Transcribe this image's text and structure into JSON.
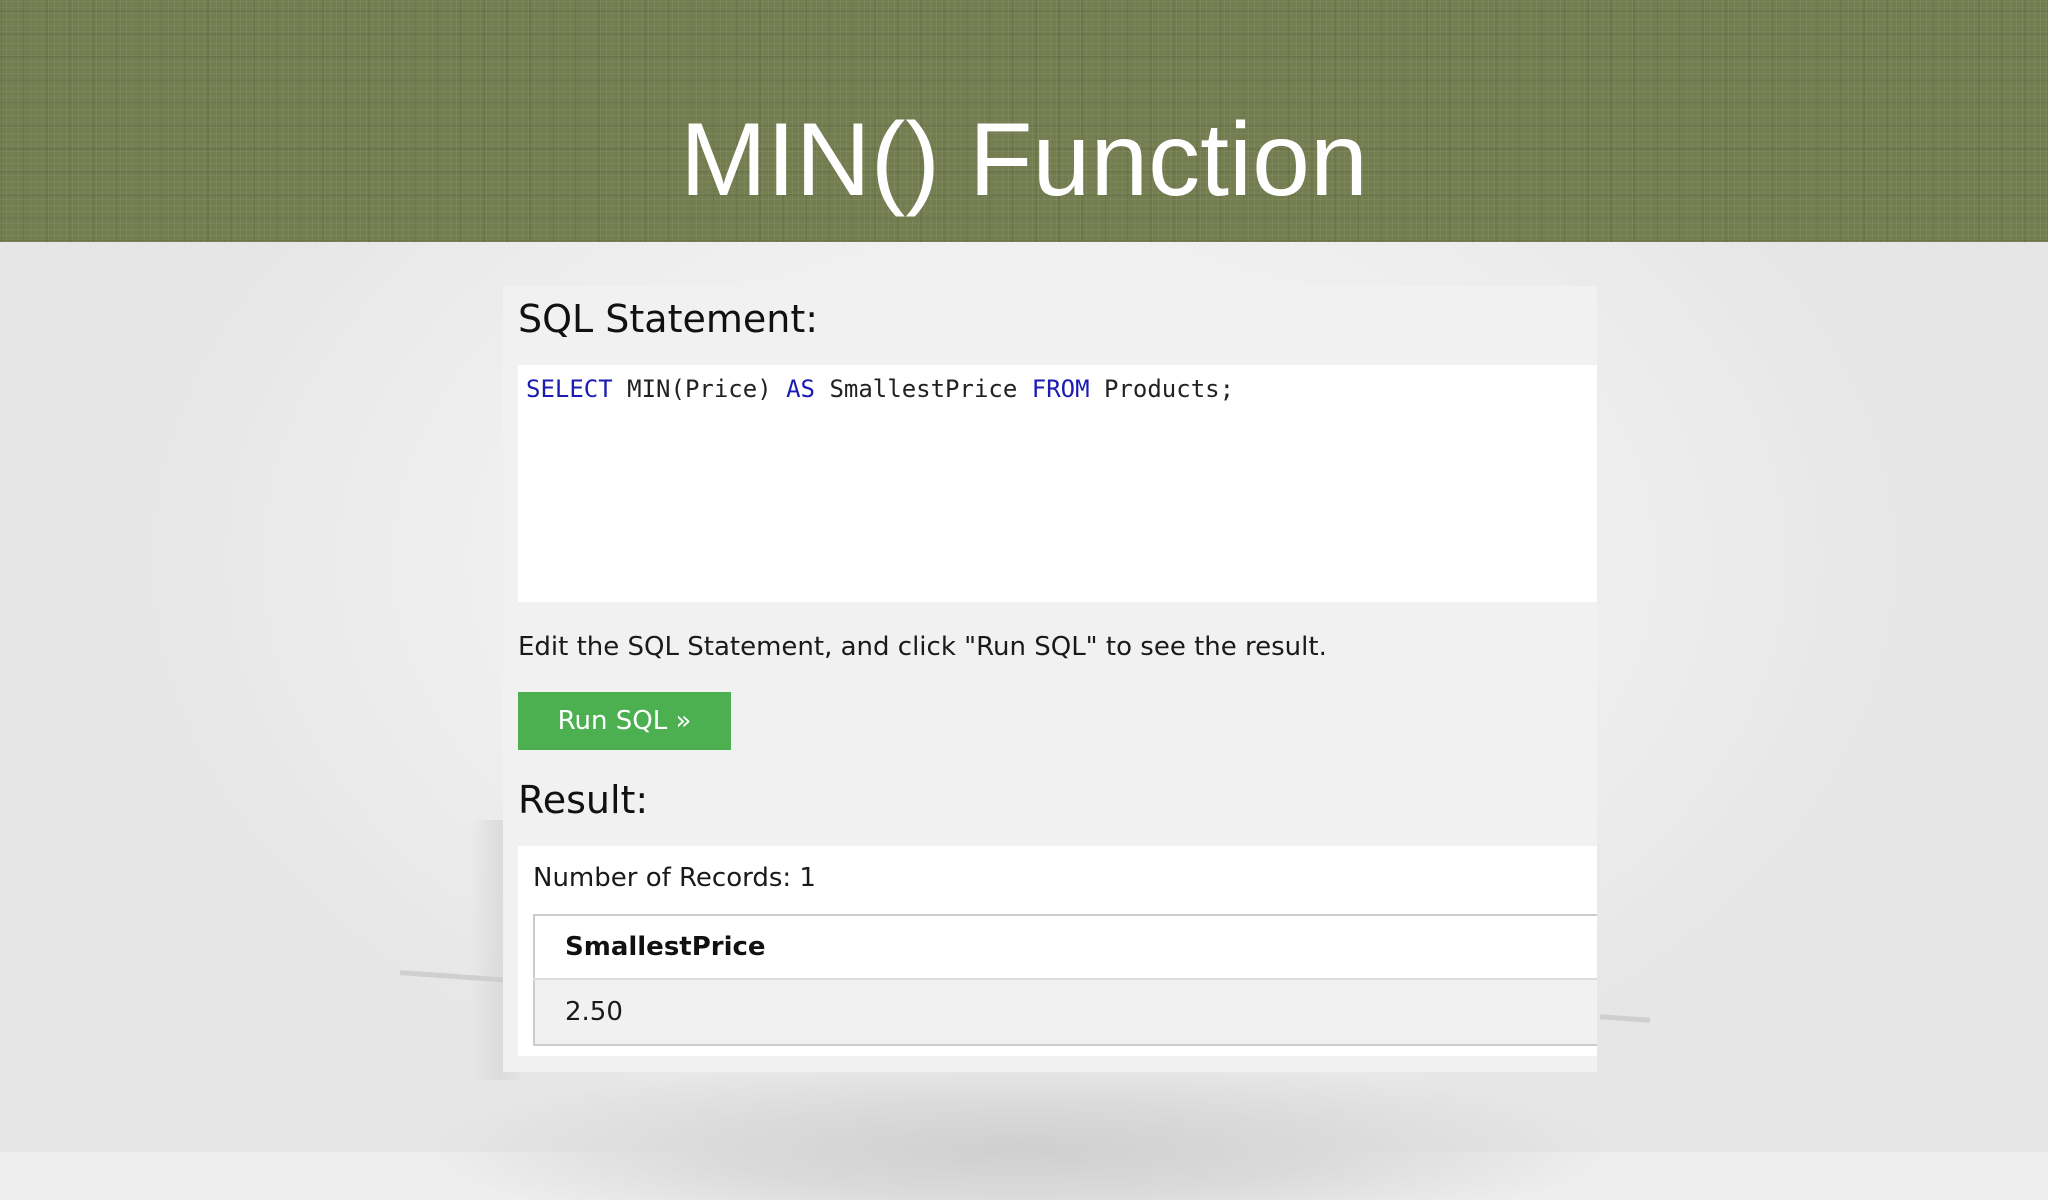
{
  "header": {
    "title": "MIN() Function"
  },
  "editor_section": {
    "heading": "SQL Statement:",
    "sql_tokens": [
      {
        "text": "SELECT",
        "kind": "keyword"
      },
      {
        "text": " MIN(Price) ",
        "kind": "plain"
      },
      {
        "text": "AS",
        "kind": "keyword"
      },
      {
        "text": " SmallestPrice ",
        "kind": "plain"
      },
      {
        "text": "FROM",
        "kind": "keyword"
      },
      {
        "text": " Products;",
        "kind": "plain"
      }
    ],
    "hint": "Edit the SQL Statement, and click \"Run SQL\" to see the result.",
    "run_button_label": "Run SQL »"
  },
  "result_section": {
    "heading": "Result:",
    "records_text": "Number of Records: 1",
    "columns": [
      "SmallestPrice"
    ],
    "rows": [
      [
        "2.50"
      ]
    ]
  },
  "colors": {
    "banner": "#737d4f",
    "button": "#4caf50",
    "sql_keyword": "#1b1bb3"
  }
}
